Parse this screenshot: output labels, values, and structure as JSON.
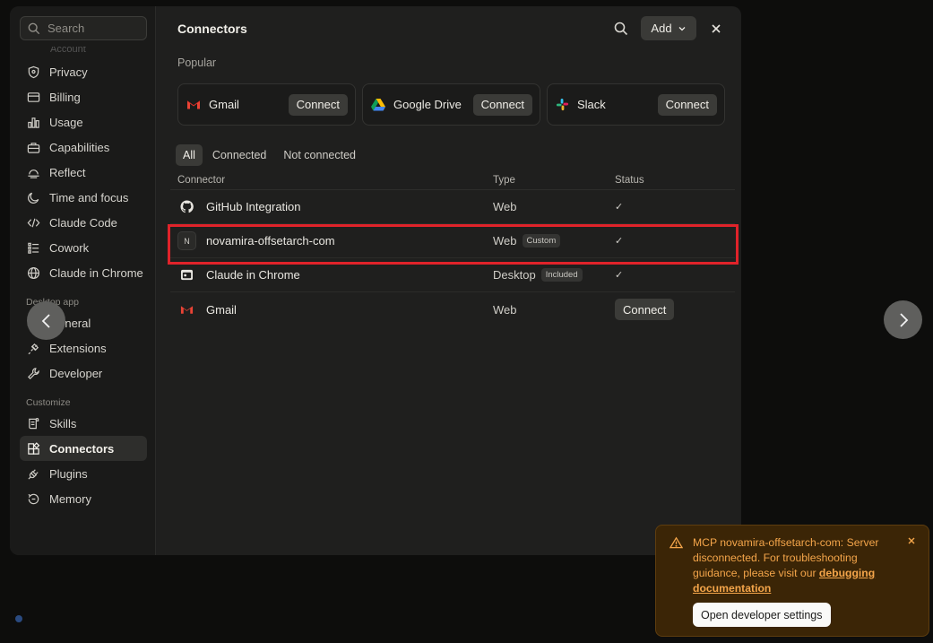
{
  "sidebar": {
    "search_placeholder": "Search",
    "faded_item": "Account",
    "items_top": [
      {
        "label": "Privacy",
        "icon": "shield-icon"
      },
      {
        "label": "Billing",
        "icon": "credit-card-icon"
      },
      {
        "label": "Usage",
        "icon": "bar-chart-icon"
      },
      {
        "label": "Capabilities",
        "icon": "toolbox-icon"
      },
      {
        "label": "Reflect",
        "icon": "reflect-icon"
      },
      {
        "label": "Time and focus",
        "icon": "moon-icon"
      },
      {
        "label": "Claude Code",
        "icon": "code-icon"
      },
      {
        "label": "Cowork",
        "icon": "list-icon"
      },
      {
        "label": "Claude in Chrome",
        "icon": "globe-icon"
      }
    ],
    "section_desktop": "Desktop app",
    "items_desktop": [
      {
        "label": "General",
        "icon": "monitor-icon"
      },
      {
        "label": "Extensions",
        "icon": "puzzle-icon"
      },
      {
        "label": "Developer",
        "icon": "wrench-icon"
      }
    ],
    "section_customize": "Customize",
    "items_customize": [
      {
        "label": "Skills",
        "icon": "scroll-icon"
      },
      {
        "label": "Connectors",
        "icon": "connector-icon",
        "active": true
      },
      {
        "label": "Plugins",
        "icon": "plug-icon"
      },
      {
        "label": "Memory",
        "icon": "memory-icon"
      }
    ]
  },
  "header": {
    "title": "Connectors",
    "add_label": "Add"
  },
  "popular": {
    "label": "Popular",
    "cards": [
      {
        "name": "Gmail",
        "action": "Connect"
      },
      {
        "name": "Google Drive",
        "action": "Connect"
      },
      {
        "name": "Slack",
        "action": "Connect"
      }
    ]
  },
  "filters": [
    "All",
    "Connected",
    "Not connected"
  ],
  "table": {
    "headers": {
      "connector": "Connector",
      "type": "Type",
      "status": "Status"
    },
    "rows": [
      {
        "name": "GitHub Integration",
        "type": "Web",
        "badge": "",
        "status": "✓"
      },
      {
        "name": "novamira-offsetarch-com",
        "type": "Web",
        "badge": "Custom",
        "status": "✓",
        "logo_letter": "N"
      },
      {
        "name": "Claude in Chrome",
        "type": "Desktop",
        "badge": "Included",
        "status": "✓"
      },
      {
        "name": "Gmail",
        "type": "Web",
        "badge": "",
        "status": "Connect"
      }
    ]
  },
  "toast": {
    "message_prefix": "MCP novamira-offsetarch-com: Server disconnected. For troubleshooting guidance, please visit our ",
    "link_text": "debugging documentation",
    "button": "Open developer settings"
  },
  "colors": {
    "accent_highlight": "#e0232a",
    "toast_text": "#f4a54a",
    "toast_bg": "#3b2506"
  }
}
